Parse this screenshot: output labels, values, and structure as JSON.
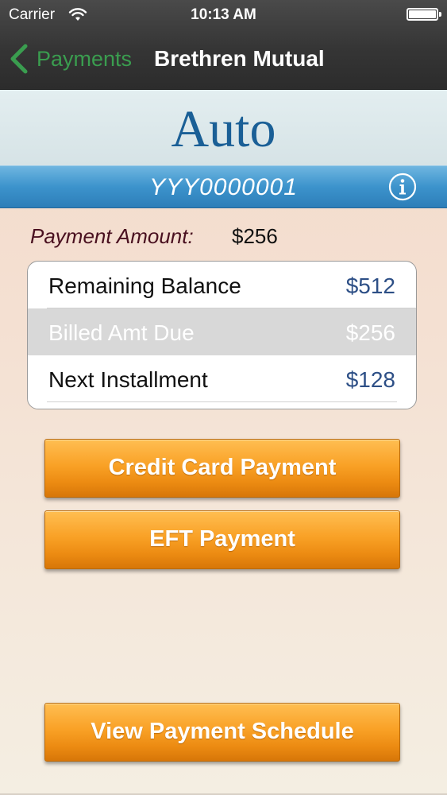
{
  "status_bar": {
    "carrier": "Carrier",
    "time": "10:13 AM",
    "icons": [
      "wifi-icon",
      "battery-icon"
    ]
  },
  "nav": {
    "back_label": "Payments",
    "title": "Brethren Mutual",
    "back_color": "#3a9d4f"
  },
  "policy": {
    "category": "Auto",
    "number": "YYY0000001",
    "info_icon": "info-icon"
  },
  "payment": {
    "amount_label": "Payment Amount:",
    "amount_value": "$256"
  },
  "balances": [
    {
      "label": "Remaining Balance",
      "value": "$512"
    },
    {
      "label": "Billed Amt Due",
      "value": "$256"
    },
    {
      "label": "Next Installment",
      "value": "$128"
    }
  ],
  "actions": {
    "credit_card": "Credit Card Payment",
    "eft": "EFT Payment",
    "schedule": "View Payment Schedule"
  },
  "colors": {
    "accent_orange": "#f9a126",
    "policy_blue": "#3c93cc",
    "category_text": "#1a5f96",
    "amount_text": "#2d4f86"
  }
}
